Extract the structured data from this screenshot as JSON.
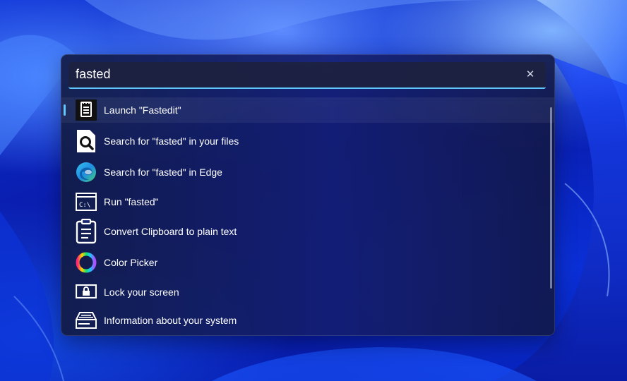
{
  "search": {
    "query": "fasted"
  },
  "results": [
    {
      "label": "Launch \"Fastedit\"",
      "icon": "notepad-icon"
    },
    {
      "label": "Search for \"fasted\" in your files",
      "icon": "file-search-icon"
    },
    {
      "label": "Search for \"fasted\" in Edge",
      "icon": "edge-icon"
    },
    {
      "label": "Run \"fasted\"",
      "icon": "terminal-icon"
    },
    {
      "label": "Convert Clipboard to plain text",
      "icon": "clipboard-icon"
    },
    {
      "label": "Color Picker",
      "icon": "color-wheel-icon"
    },
    {
      "label": "Lock your screen",
      "icon": "lock-icon"
    },
    {
      "label": "Information about your system",
      "icon": "system-info-icon"
    }
  ],
  "colors": {
    "accent": "#5ec8ff"
  }
}
